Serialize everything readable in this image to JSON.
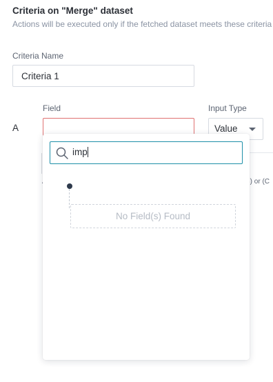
{
  "header": {
    "title": "Criteria on \"Merge\" dataset",
    "subtitle": "Actions will be executed only if the fetched dataset meets these criteria"
  },
  "criteria_name": {
    "label": "Criteria Name",
    "value": "Criteria 1"
  },
  "criteria_row": {
    "letter": "A",
    "field_label": "Field",
    "field_value": "",
    "input_type_label": "Input Type",
    "input_type_value": "Value"
  },
  "background_fragments": {
    "left": "A",
    "right": "B) or (C"
  },
  "dropdown": {
    "search_value": "imp",
    "empty_message": "No Field(s) Found"
  },
  "icons": {
    "search": "search-icon",
    "caret": "chevron-down-icon"
  },
  "colors": {
    "accent": "#1c8fa8",
    "error_border": "#e07070",
    "muted_text": "#8a93a3"
  }
}
